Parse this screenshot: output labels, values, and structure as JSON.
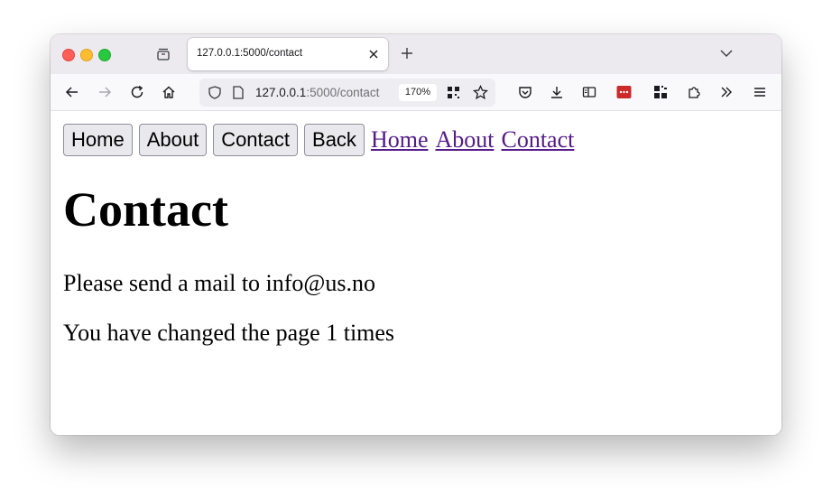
{
  "browser": {
    "tab": {
      "title": "127.0.0.1:5000/contact"
    },
    "url": {
      "host": "127.0.0.1",
      "path": ":5000/contact"
    },
    "zoom": "170%"
  },
  "page": {
    "buttons": [
      "Home",
      "About",
      "Contact",
      "Back"
    ],
    "links": [
      "Home",
      "About",
      "Contact"
    ],
    "heading": "Contact",
    "paragraphs": [
      "Please send a mail to info@us.no",
      "You have changed the page 1 times"
    ]
  },
  "colors": {
    "link_visited": "#551a8b",
    "button_bg": "#e9e9ed",
    "chrome_bg": "#eceaef"
  }
}
